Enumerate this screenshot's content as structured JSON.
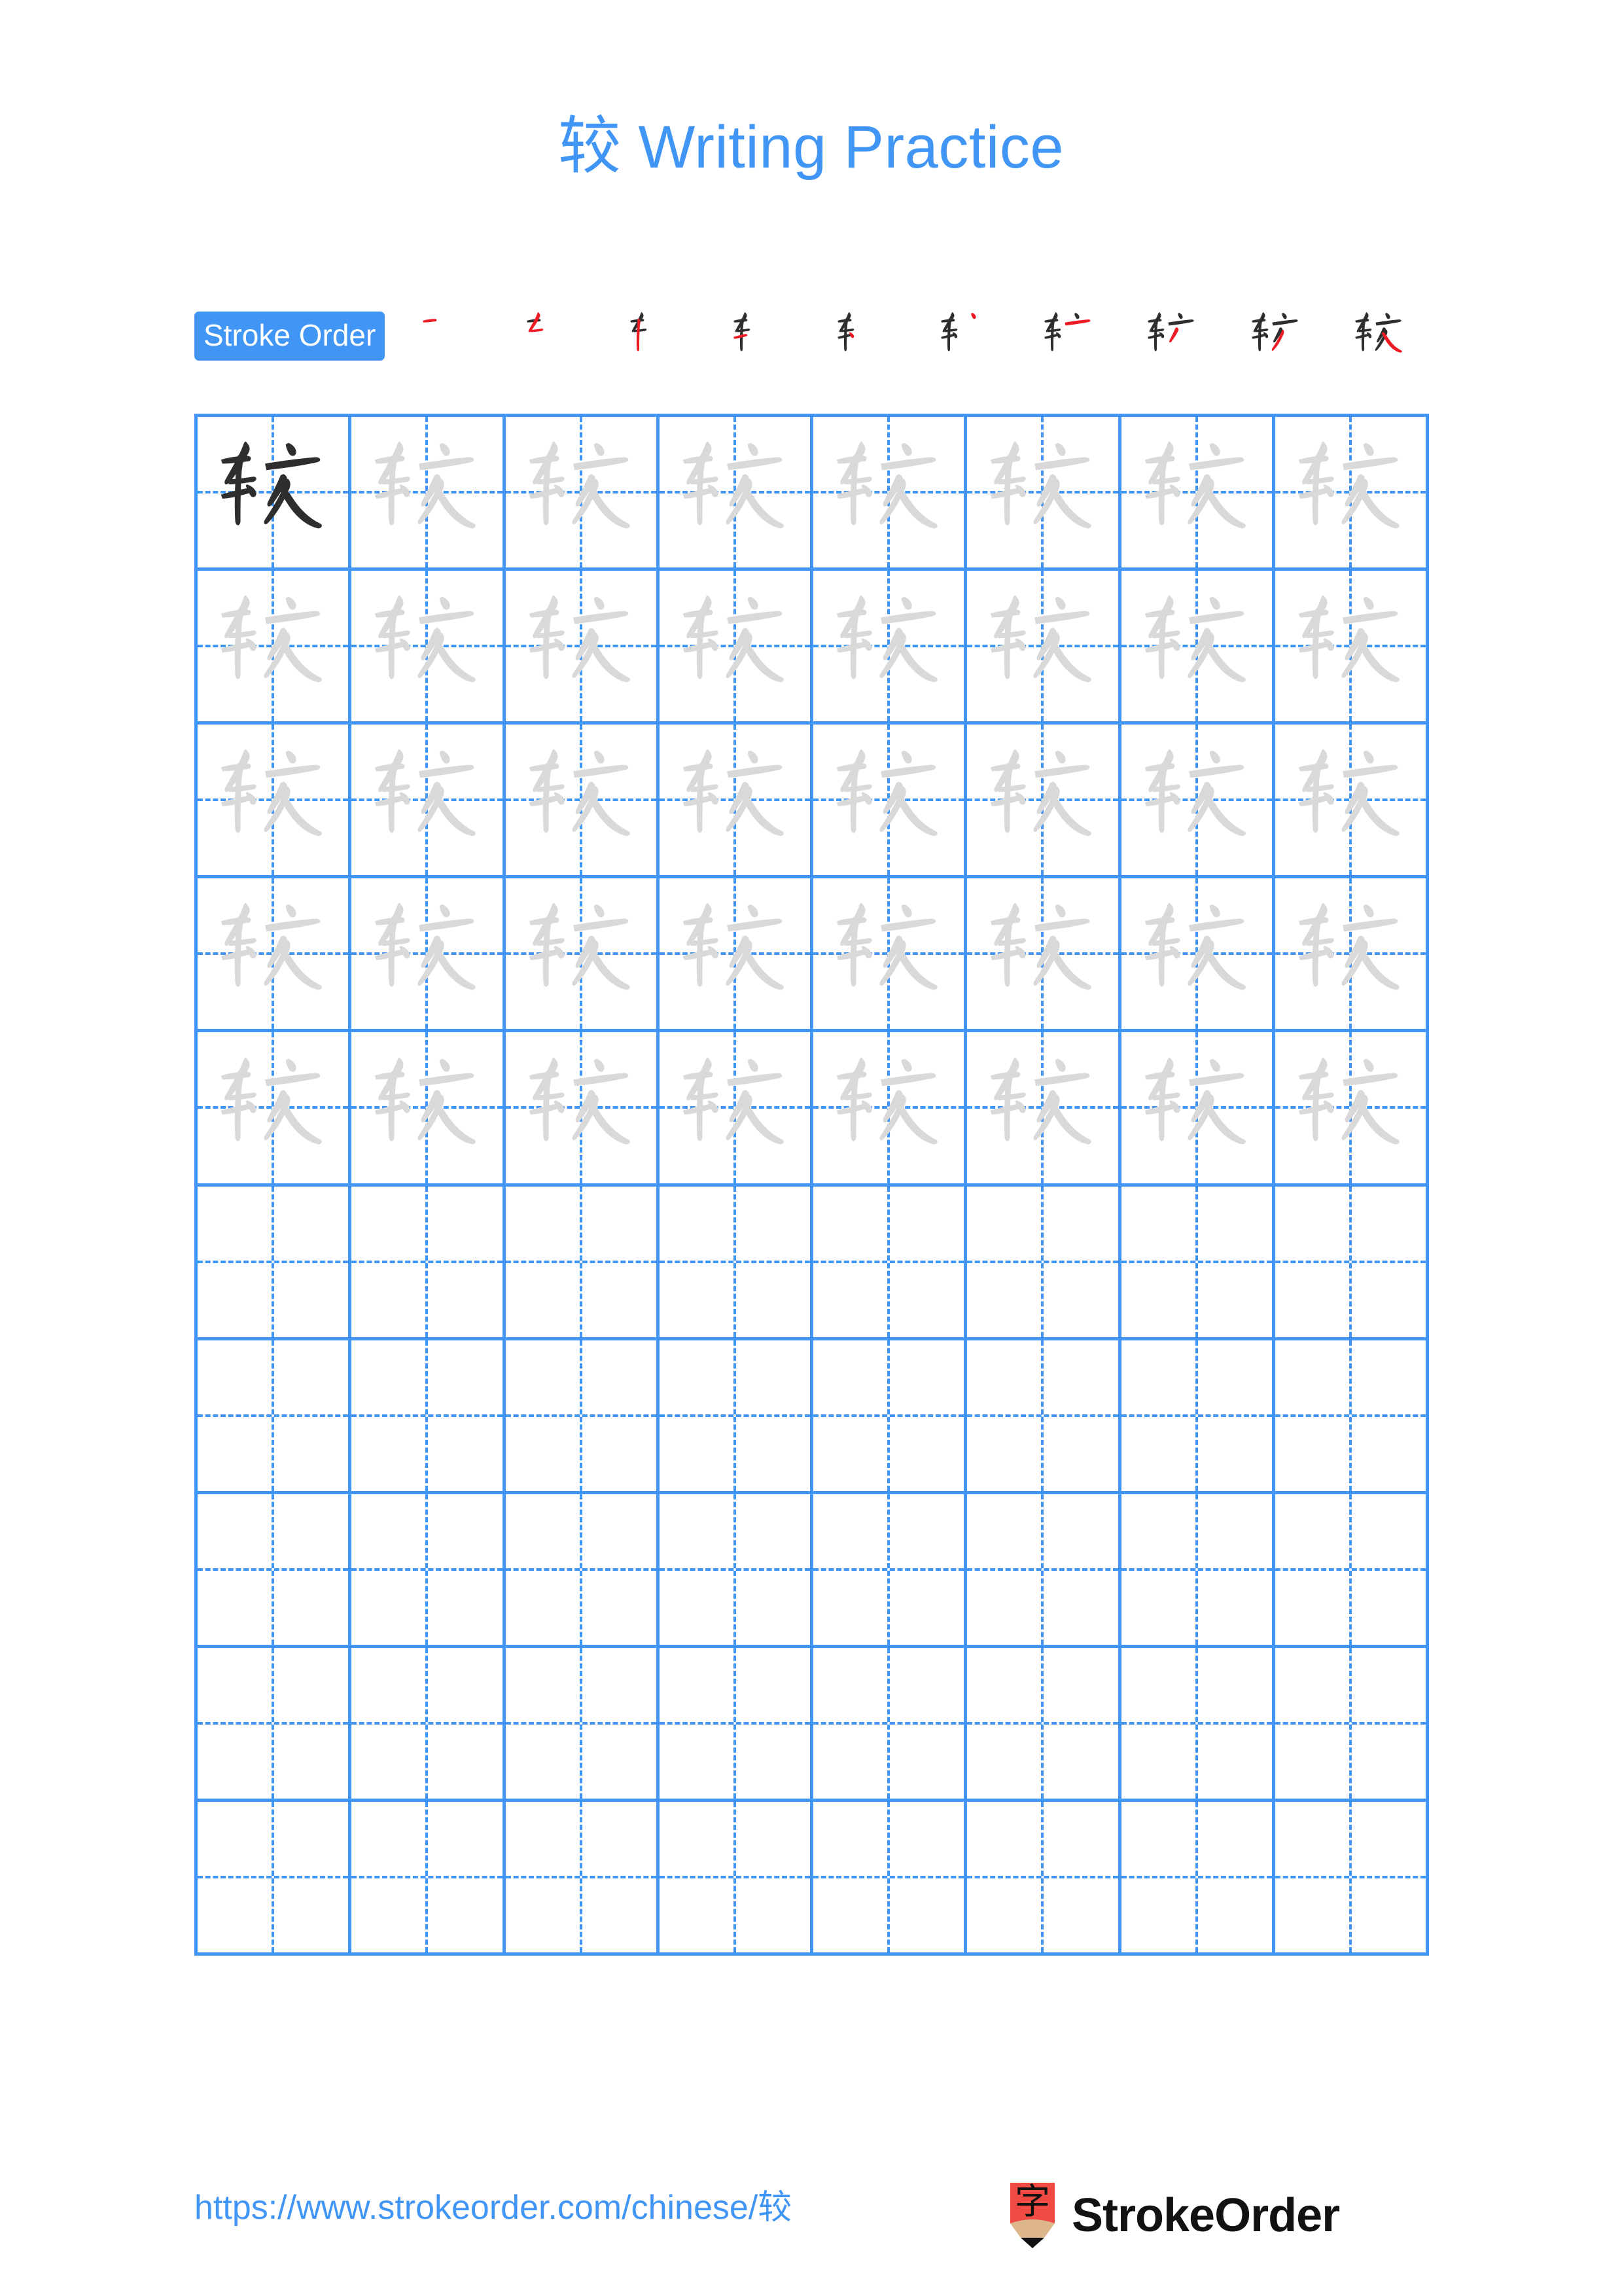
{
  "page": {
    "character": "较",
    "title": "较 Writing Practice",
    "title_character": "较",
    "title_text": " Writing Practice",
    "accent_color": "#4196F5",
    "trace_gray": "#D9D9D9",
    "ink_dark": "#2E2E2E",
    "stroke_new_color": "#ED1C24"
  },
  "stroke_order": {
    "badge_label": "Stroke Order",
    "stroke_count": 10,
    "steps": [
      {
        "index": 1,
        "label": "stroke-1"
      },
      {
        "index": 2,
        "label": "stroke-2"
      },
      {
        "index": 3,
        "label": "stroke-3"
      },
      {
        "index": 4,
        "label": "stroke-4"
      },
      {
        "index": 5,
        "label": "stroke-5"
      },
      {
        "index": 6,
        "label": "stroke-6"
      },
      {
        "index": 7,
        "label": "stroke-7"
      },
      {
        "index": 8,
        "label": "stroke-8"
      },
      {
        "index": 9,
        "label": "stroke-9"
      },
      {
        "index": 10,
        "label": "stroke-10"
      }
    ]
  },
  "practice_grid": {
    "columns": 8,
    "rows": 10,
    "filled_rows": 5,
    "example_cell_index": 0,
    "cell_character": "较",
    "cells": [
      "dark",
      "trace",
      "trace",
      "trace",
      "trace",
      "trace",
      "trace",
      "trace",
      "trace",
      "trace",
      "trace",
      "trace",
      "trace",
      "trace",
      "trace",
      "trace",
      "trace",
      "trace",
      "trace",
      "trace",
      "trace",
      "trace",
      "trace",
      "trace",
      "trace",
      "trace",
      "trace",
      "trace",
      "trace",
      "trace",
      "trace",
      "trace",
      "trace",
      "trace",
      "trace",
      "trace",
      "trace",
      "trace",
      "trace",
      "trace",
      "empty",
      "empty",
      "empty",
      "empty",
      "empty",
      "empty",
      "empty",
      "empty",
      "empty",
      "empty",
      "empty",
      "empty",
      "empty",
      "empty",
      "empty",
      "empty",
      "empty",
      "empty",
      "empty",
      "empty",
      "empty",
      "empty",
      "empty",
      "empty",
      "empty",
      "empty",
      "empty",
      "empty",
      "empty",
      "empty",
      "empty",
      "empty",
      "empty",
      "empty",
      "empty",
      "empty",
      "empty",
      "empty",
      "empty",
      "empty"
    ]
  },
  "footer": {
    "url": "https://www.strokeorder.com/chinese/较",
    "brand_name": "StrokeOrder",
    "brand_mark_character": "字",
    "brand_mark_body_color": "#EF4A44",
    "brand_mark_wood_color": "#DDB68C",
    "brand_mark_tip_color": "#111111"
  }
}
